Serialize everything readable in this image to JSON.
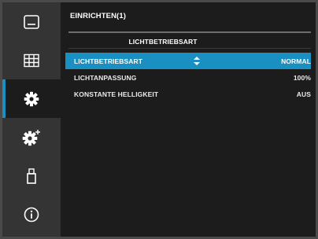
{
  "sidebar": {
    "items": [
      {
        "icon": "picture-icon"
      },
      {
        "icon": "grid-icon"
      },
      {
        "icon": "gear-icon",
        "active": true
      },
      {
        "icon": "gear-plus-icon"
      },
      {
        "icon": "usb-icon"
      },
      {
        "icon": "info-icon"
      }
    ]
  },
  "menu": {
    "title": "EINRICHTEN(1)",
    "subtitle": "LICHTBETRIEBSART",
    "rows": [
      {
        "label": "LICHTBETRIEBSART",
        "value": "NORMAL"
      },
      {
        "label": "LICHTANPASSUNG",
        "value": "100%"
      },
      {
        "label": "KONSTANTE HELLIGKEIT",
        "value": "AUS"
      }
    ]
  },
  "colors": {
    "accent": "#1a8fc1",
    "panel": "#1c1c1c",
    "sidebar": "#343434",
    "frame": "#4a4a4a"
  }
}
